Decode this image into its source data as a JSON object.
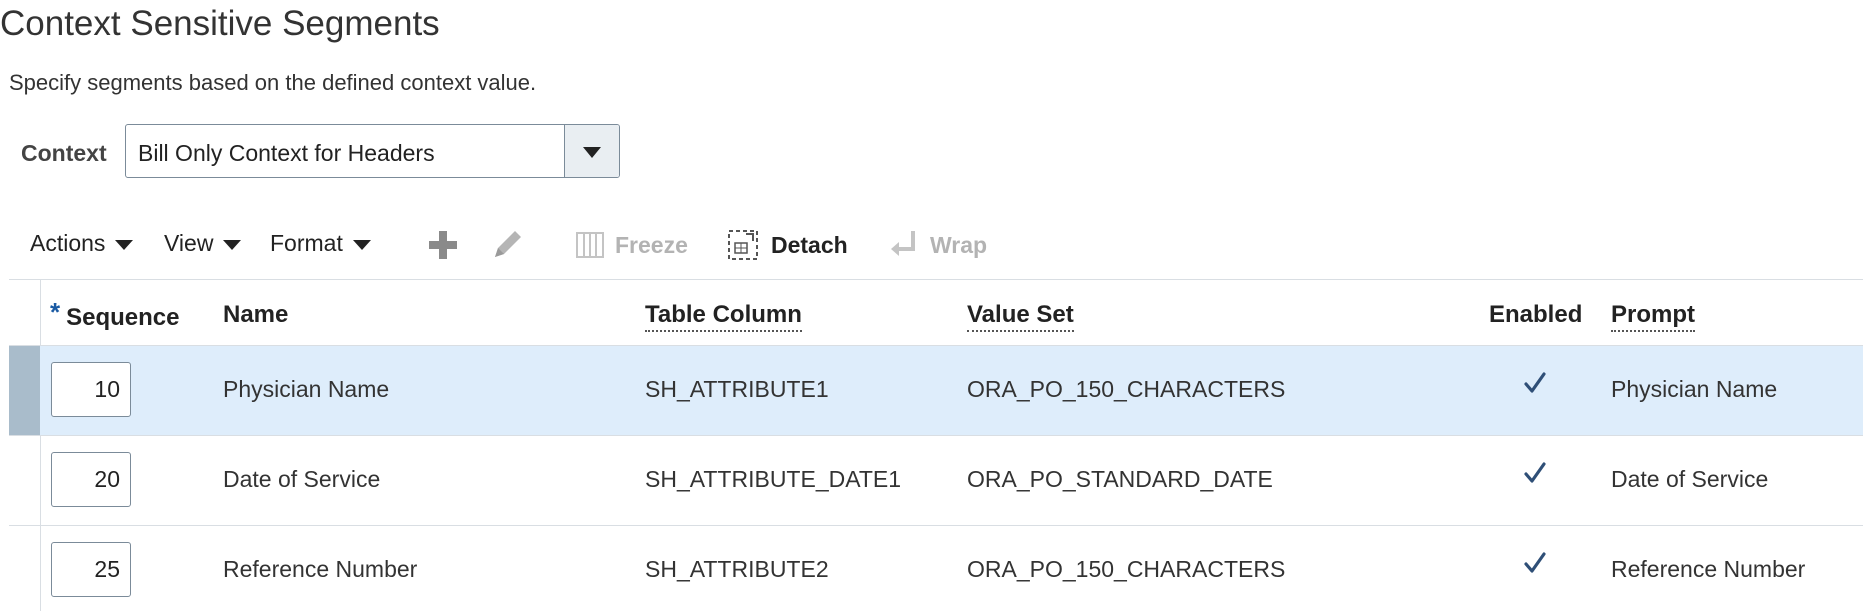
{
  "page": {
    "title": "Context Sensitive Segments",
    "description": "Specify segments based on the defined context value."
  },
  "context": {
    "label": "Context",
    "value": "Bill Only Context for Headers"
  },
  "toolbar": {
    "actions_label": "Actions",
    "view_label": "View",
    "format_label": "Format",
    "freeze_label": "Freeze",
    "detach_label": "Detach",
    "wrap_label": "Wrap"
  },
  "table": {
    "headers": {
      "required_marker": "*",
      "sequence": "Sequence",
      "name": "Name",
      "table_column": "Table Column",
      "value_set": "Value Set",
      "enabled": "Enabled",
      "prompt": "Prompt"
    },
    "rows": [
      {
        "sequence": "10",
        "name": "Physician Name",
        "table_column": "SH_ATTRIBUTE1",
        "value_set": "ORA_PO_150_CHARACTERS",
        "enabled": true,
        "prompt": "Physician Name",
        "selected": true
      },
      {
        "sequence": "20",
        "name": "Date of Service",
        "table_column": "SH_ATTRIBUTE_DATE1",
        "value_set": "ORA_PO_STANDARD_DATE",
        "enabled": true,
        "prompt": "Date of Service",
        "selected": false
      },
      {
        "sequence": "25",
        "name": "Reference Number",
        "table_column": "SH_ATTRIBUTE2",
        "value_set": "ORA_PO_150_CHARACTERS",
        "enabled": true,
        "prompt": "Reference Number",
        "selected": false
      }
    ]
  },
  "colors": {
    "selected_row": "#deedfb",
    "row_marker": "#a9bccb",
    "check": "#2f4f77",
    "required": "#1a5aa3"
  }
}
